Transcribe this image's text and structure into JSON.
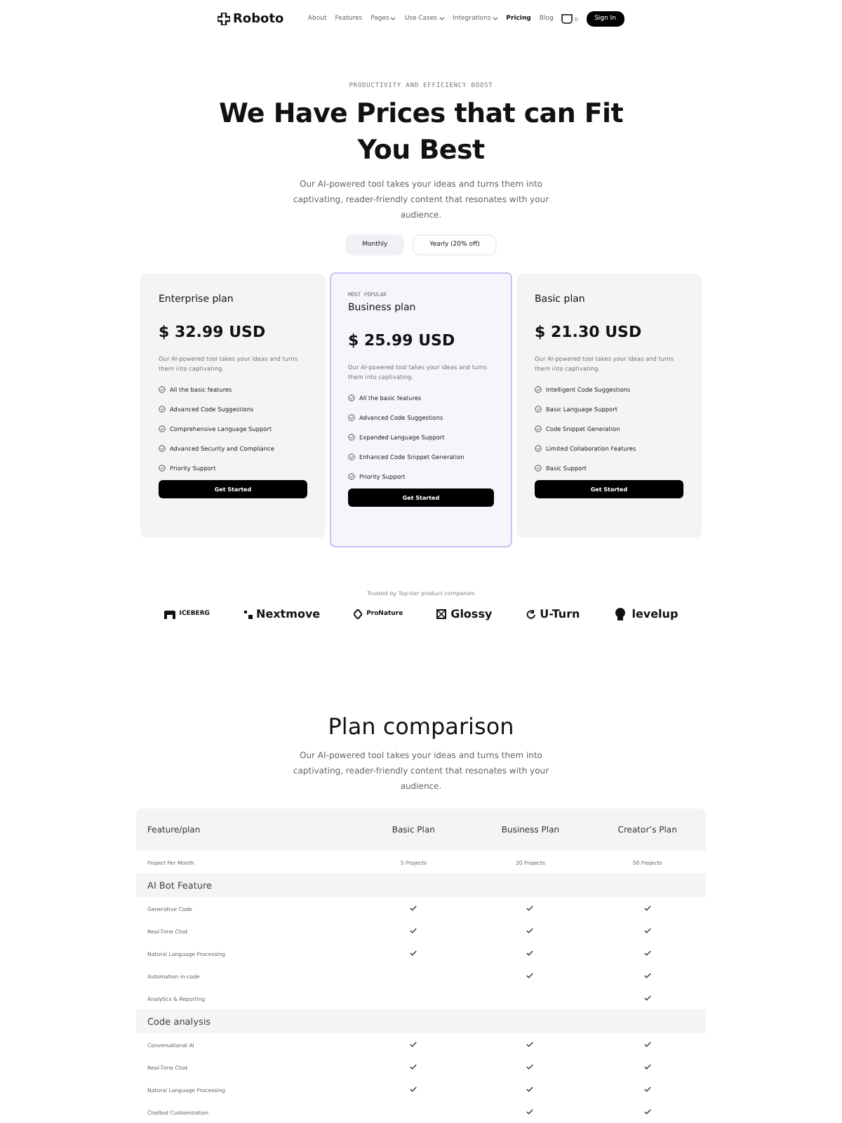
{
  "nav": {
    "brand": "Roboto",
    "links": [
      {
        "label": "About",
        "dropdown": false,
        "selected": false
      },
      {
        "label": "Features",
        "dropdown": false,
        "selected": false
      },
      {
        "label": "Pages",
        "dropdown": true,
        "selected": false
      },
      {
        "label": "Use Cases",
        "dropdown": true,
        "selected": false
      },
      {
        "label": "Integrations",
        "dropdown": true,
        "selected": false
      },
      {
        "label": "Pricing",
        "dropdown": false,
        "selected": true
      },
      {
        "label": "Blog",
        "dropdown": false,
        "selected": false
      }
    ],
    "cart_count": "0",
    "signin": "Sign In"
  },
  "hero": {
    "eyebrow": "PRODUCTIVITY AND EFFICIENCY BOOST",
    "title": "We Have Prices that can Fit You Best",
    "text": "Our AI-powered tool takes your ideas and turns them into captivating, reader-friendly content that resonates with your audience.",
    "toggle": [
      {
        "label": "Monthly",
        "selected": true
      },
      {
        "label": "Yearly (20% off)",
        "selected": false
      }
    ]
  },
  "plans": [
    {
      "name": "Enterprise plan",
      "price": "$ 32.99 USD",
      "text": "Our AI-powered tool takes your ideas and turns them into captivating.",
      "features": [
        "All the basic features",
        "Advanced Code Suggestions",
        "Comprehensive Language Support",
        "Advanced Security and Compliance",
        "Priority Support"
      ],
      "button": "Get Started",
      "highlighted": false
    },
    {
      "badge": "MOST POPULAR",
      "name": "Business plan",
      "price": "$ 25.99 USD",
      "text": "Our AI-powered tool takes your ideas and turns them into captivating.",
      "features": [
        "All the basic features",
        "Advanced Code Suggestions",
        "Expanded Language Support",
        "Enhanced Code Snippet Generation",
        "Priority Support"
      ],
      "button": "Get Started",
      "highlighted": true
    },
    {
      "name": "Basic plan",
      "price": "$ 21.30 USD",
      "text": "Our AI-powered tool takes your ideas and turns them into captivating.",
      "features": [
        "Intelligent Code Suggestions",
        "Basic Language Support",
        "Code Snippet Generation",
        "Limited Collaboration Features",
        "Basic Support"
      ],
      "button": "Get Started",
      "highlighted": false
    }
  ],
  "trusted": {
    "caption": "Trusted by Top-tier product companies",
    "logos": [
      "ICEBERG",
      "Nextmove",
      "ProNature",
      "Glossy",
      "U-Turn",
      "levelup"
    ]
  },
  "comparison": {
    "title": "Plan comparison",
    "text": "Our AI-powered tool takes your ideas and turns them into captivating, reader-friendly content that resonates with your audience.",
    "columns": [
      "Feature/plan",
      "Basic Plan",
      "Business Plan",
      "Creator’s Plan"
    ],
    "rows": [
      {
        "kind": "value",
        "label": "Project Per Month",
        "values": [
          "5 Projects",
          "20 Projects",
          "50 Projects"
        ]
      },
      {
        "kind": "section",
        "label": "AI Bot Feature"
      },
      {
        "kind": "feature",
        "label": "Generative Code",
        "checks": [
          true,
          true,
          true
        ]
      },
      {
        "kind": "feature",
        "label": "Real-Time Chat",
        "checks": [
          true,
          true,
          true
        ]
      },
      {
        "kind": "feature",
        "label": "Natural Language Processing",
        "checks": [
          true,
          true,
          true
        ]
      },
      {
        "kind": "feature",
        "label": "Automation in-code",
        "checks": [
          false,
          true,
          true
        ]
      },
      {
        "kind": "feature",
        "label": "Analytics & Reporting",
        "checks": [
          false,
          false,
          true
        ]
      },
      {
        "kind": "section",
        "label": "Code analysis"
      },
      {
        "kind": "feature",
        "label": "Conversational AI",
        "checks": [
          true,
          true,
          true
        ]
      },
      {
        "kind": "feature",
        "label": "Real-Time Chat",
        "checks": [
          true,
          true,
          true
        ]
      },
      {
        "kind": "feature",
        "label": "Natural Language Processing",
        "checks": [
          true,
          true,
          true
        ]
      },
      {
        "kind": "feature",
        "label": "Chatbot Customization",
        "checks": [
          false,
          true,
          true
        ]
      }
    ]
  }
}
